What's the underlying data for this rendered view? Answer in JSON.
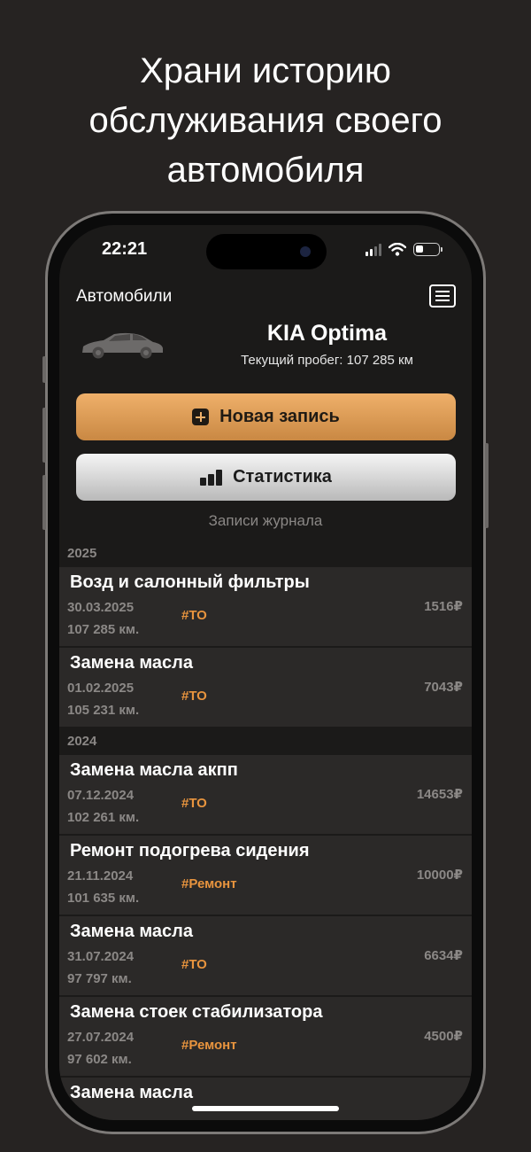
{
  "promo": {
    "headline_lines": [
      "Храни историю",
      "обслуживания своего",
      "автомобиля"
    ]
  },
  "status_bar": {
    "time": "22:21"
  },
  "header": {
    "title": "Автомобили",
    "menu_icon": "list-icon"
  },
  "car": {
    "name": "KIA Optima",
    "mileage": "Текущий пробег: 107 285 км",
    "image_icon": "car-silhouette-icon"
  },
  "actions": {
    "new_record": "Новая запись",
    "statistics": "Статистика"
  },
  "journal": {
    "label": "Записи журнала",
    "groups": [
      {
        "year": "2025",
        "entries": [
          {
            "title": "Возд и салонный фильтры",
            "date": "30.03.2025",
            "km": "107 285 км.",
            "tag": "#ТО",
            "price": "1516₽"
          },
          {
            "title": "Замена масла",
            "date": "01.02.2025",
            "km": "105 231 км.",
            "tag": "#ТО",
            "price": "7043₽"
          }
        ]
      },
      {
        "year": "2024",
        "entries": [
          {
            "title": "Замена масла акпп",
            "date": "07.12.2024",
            "km": "102 261 км.",
            "tag": "#ТО",
            "price": "14653₽"
          },
          {
            "title": "Ремонт подогрева сидения",
            "date": "21.11.2024",
            "km": "101 635 км.",
            "tag": "#Ремонт",
            "price": "10000₽"
          },
          {
            "title": "Замена масла",
            "date": "31.07.2024",
            "km": "97 797 км.",
            "tag": "#ТО",
            "price": "6634₽"
          },
          {
            "title": "Замена стоек стабилизатора",
            "date": "27.07.2024",
            "km": "97 602 км.",
            "tag": "#Ремонт",
            "price": "4500₽"
          },
          {
            "title": "Замена масла",
            "date": "",
            "km": "",
            "tag": "",
            "price": ""
          }
        ]
      }
    ]
  },
  "colors": {
    "accent": "#e8943e",
    "background": "#262322",
    "row": "#2b2928"
  }
}
